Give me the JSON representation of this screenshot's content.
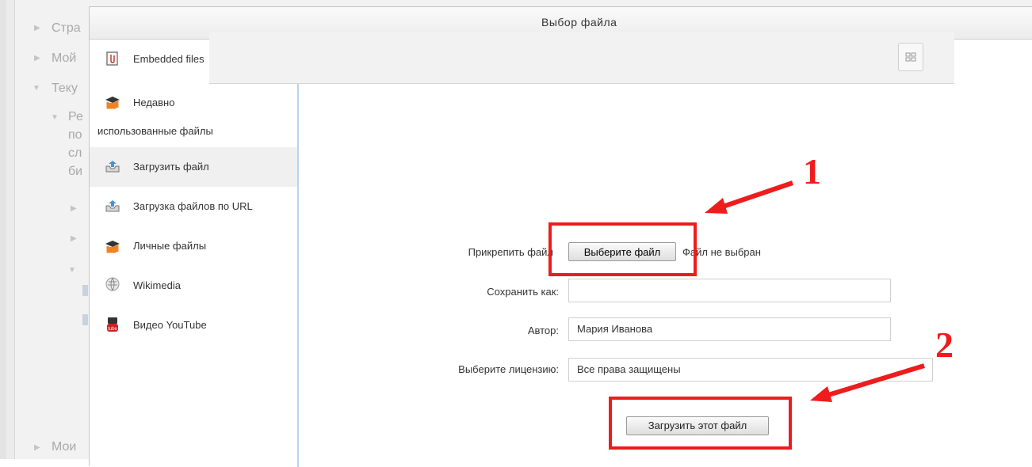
{
  "background": {
    "nav_items": [
      "Стра",
      "Мой",
      "Теку",
      "Ре",
      "по",
      "сл",
      "би",
      "Мои"
    ]
  },
  "dialog": {
    "title": "Выбор файла"
  },
  "sidebar": {
    "items": [
      {
        "label": "Embedded files",
        "icon": "embedded-files-icon"
      },
      {
        "label": "Недавно",
        "label2": "использованные файлы",
        "icon": "moodle-icon"
      },
      {
        "label": "Загрузить файл",
        "icon": "upload-icon",
        "active": true
      },
      {
        "label": "Загрузка файлов по URL",
        "icon": "upload-icon"
      },
      {
        "label": "Личные файлы",
        "icon": "moodle-icon"
      },
      {
        "label": "Wikimedia",
        "icon": "wikimedia-icon"
      },
      {
        "label": "Видео YouTube",
        "icon": "youtube-icon"
      }
    ]
  },
  "form": {
    "attach_label": "Прикрепить файл",
    "choose_button": "Выберите файл",
    "no_file": "Файл не выбран",
    "save_as_label": "Сохранить как:",
    "save_as_value": "",
    "author_label": "Автор:",
    "author_value": "Мария Иванова",
    "license_label": "Выберите лицензию:",
    "license_value": "Все права защищены",
    "upload_button": "Загрузить этот файл"
  },
  "annotations": {
    "num1": "1",
    "num2": "2",
    "color": "#ee1c1c"
  }
}
